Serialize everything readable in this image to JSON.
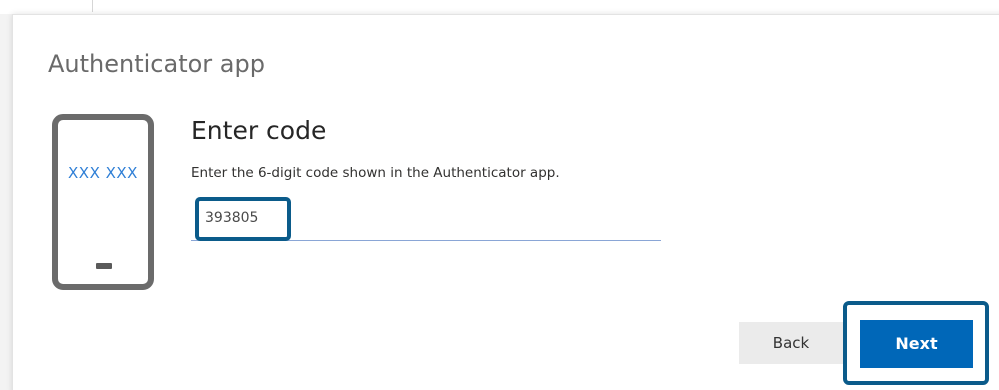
{
  "section": {
    "title": "Authenticator app"
  },
  "illustration": {
    "phone_code": "XXX XXX"
  },
  "form": {
    "heading": "Enter code",
    "instruction": "Enter the 6-digit code shown in the Authenticator app.",
    "code_value": "393805"
  },
  "buttons": {
    "back_label": "Back",
    "next_label": "Next"
  },
  "colors": {
    "accent": "#0067b8",
    "highlight_border": "#0b5b8a",
    "phone_code_text": "#2f7fd6"
  },
  "icons": {
    "phone": "smartphone-icon"
  }
}
